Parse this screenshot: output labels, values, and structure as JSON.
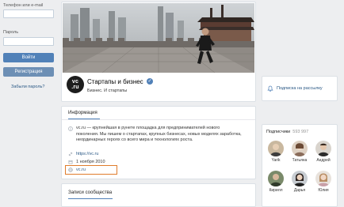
{
  "login": {
    "phone_label": "Телефон или e-mail",
    "password_label": "Пароль",
    "login_button": "Войти",
    "register_button": "Регистрация",
    "forgot_link": "Забыли пароль?"
  },
  "group": {
    "logo_line1": "vc",
    "logo_line2": ".ru",
    "name": "Стартапы и бизнес",
    "status": "Бизнес. И стартапы"
  },
  "info": {
    "title": "Информация",
    "description": "vc.ru — крупнейшая в рунете площадка для предпринимателей нового поколения. Мы пишем о стартапах, крупных бизнесах, новых моделях заработка, неординарных героях со всего мира и технологиях роста.",
    "website": "https://vc.ru",
    "founded": "1 ноября 2010",
    "link": "vc.ru"
  },
  "wall": {
    "title": "Записи сообщества"
  },
  "subscribe": {
    "label": "Подписка на рассылку"
  },
  "subscribers": {
    "title": "Подписчики",
    "count": "593 997",
    "people": [
      {
        "name": "Yarik"
      },
      {
        "name": "Татьяна"
      },
      {
        "name": "Андрей"
      },
      {
        "name": "Кирилл"
      },
      {
        "name": "Дарья"
      },
      {
        "name": "Юлия"
      }
    ]
  },
  "colors": {
    "accent": "#5181b8",
    "link": "#2a5885",
    "highlight": "#e07c2c",
    "background": "#edeef0"
  }
}
